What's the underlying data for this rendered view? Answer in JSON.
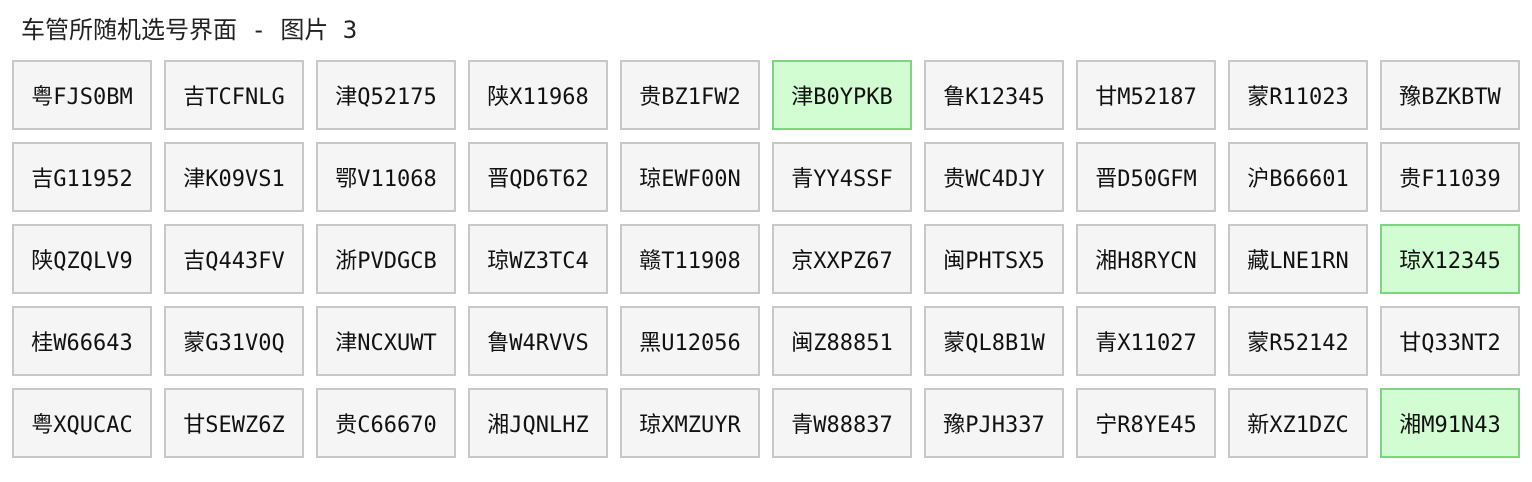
{
  "page": {
    "title": "车管所随机选号界面 - 图片 3"
  },
  "colors": {
    "plate_bg": "#f5f5f5",
    "plate_border": "#c8c8c8",
    "selected_bg": "#d2fcd2",
    "selected_border": "#7fd47f"
  },
  "plates": [
    {
      "text": "粤FJS0BM",
      "selected": false
    },
    {
      "text": "吉TCFNLG",
      "selected": false
    },
    {
      "text": "津Q52175",
      "selected": false
    },
    {
      "text": "陕X11968",
      "selected": false
    },
    {
      "text": "贵BZ1FW2",
      "selected": false
    },
    {
      "text": "津B0YPKB",
      "selected": true
    },
    {
      "text": "鲁K12345",
      "selected": false
    },
    {
      "text": "甘M52187",
      "selected": false
    },
    {
      "text": "蒙R11023",
      "selected": false
    },
    {
      "text": "豫BZKBTW",
      "selected": false
    },
    {
      "text": "吉G11952",
      "selected": false
    },
    {
      "text": "津K09VS1",
      "selected": false
    },
    {
      "text": "鄂V11068",
      "selected": false
    },
    {
      "text": "晋QD6T62",
      "selected": false
    },
    {
      "text": "琼EWF00N",
      "selected": false
    },
    {
      "text": "青YY4SSF",
      "selected": false
    },
    {
      "text": "贵WC4DJY",
      "selected": false
    },
    {
      "text": "晋D50GFM",
      "selected": false
    },
    {
      "text": "沪B66601",
      "selected": false
    },
    {
      "text": "贵F11039",
      "selected": false
    },
    {
      "text": "陕QZQLV9",
      "selected": false
    },
    {
      "text": "吉Q443FV",
      "selected": false
    },
    {
      "text": "浙PVDGCB",
      "selected": false
    },
    {
      "text": "琼WZ3TC4",
      "selected": false
    },
    {
      "text": "赣T11908",
      "selected": false
    },
    {
      "text": "京XXPZ67",
      "selected": false
    },
    {
      "text": "闽PHTSX5",
      "selected": false
    },
    {
      "text": "湘H8RYCN",
      "selected": false
    },
    {
      "text": "藏LNE1RN",
      "selected": false
    },
    {
      "text": "琼X12345",
      "selected": true
    },
    {
      "text": "桂W66643",
      "selected": false
    },
    {
      "text": "蒙G31V0Q",
      "selected": false
    },
    {
      "text": "津NCXUWT",
      "selected": false
    },
    {
      "text": "鲁W4RVVS",
      "selected": false
    },
    {
      "text": "黑U12056",
      "selected": false
    },
    {
      "text": "闽Z88851",
      "selected": false
    },
    {
      "text": "蒙QL8B1W",
      "selected": false
    },
    {
      "text": "青X11027",
      "selected": false
    },
    {
      "text": "蒙R52142",
      "selected": false
    },
    {
      "text": "甘Q33NT2",
      "selected": false
    },
    {
      "text": "粤XQUCAC",
      "selected": false
    },
    {
      "text": "甘SEWZ6Z",
      "selected": false
    },
    {
      "text": "贵C66670",
      "selected": false
    },
    {
      "text": "湘JQNLHZ",
      "selected": false
    },
    {
      "text": "琼XMZUYR",
      "selected": false
    },
    {
      "text": "青W88837",
      "selected": false
    },
    {
      "text": "豫PJH337",
      "selected": false
    },
    {
      "text": "宁R8YE45",
      "selected": false
    },
    {
      "text": "新XZ1DZC",
      "selected": false
    },
    {
      "text": "湘M91N43",
      "selected": true
    }
  ]
}
